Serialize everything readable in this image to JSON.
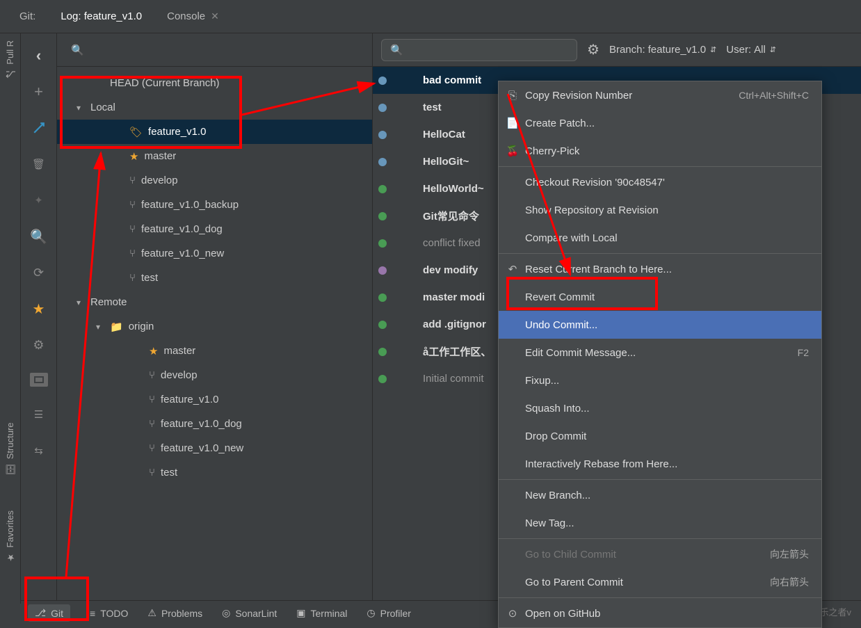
{
  "top_tabs": {
    "git_label": "Git:",
    "log_label": "Log: feature_v1.0",
    "console_label": "Console"
  },
  "vert_labels": {
    "pull": "Pull R",
    "structure": "Structure",
    "favorites": "Favorites"
  },
  "toolbar_left": {
    "back": "‹"
  },
  "tree": {
    "head": "HEAD (Current Branch)",
    "local": "Local",
    "local_items": [
      {
        "name": "feature_v1.0",
        "icon": "tag",
        "sel": true
      },
      {
        "name": "master",
        "icon": "star"
      },
      {
        "name": "develop",
        "icon": "branch"
      },
      {
        "name": "feature_v1.0_backup",
        "icon": "branch"
      },
      {
        "name": "feature_v1.0_dog",
        "icon": "branch"
      },
      {
        "name": "feature_v1.0_new",
        "icon": "branch"
      },
      {
        "name": "test",
        "icon": "branch"
      }
    ],
    "remote": "Remote",
    "origin": "origin",
    "remote_items": [
      {
        "name": "master",
        "icon": "star"
      },
      {
        "name": "develop",
        "icon": "branch"
      },
      {
        "name": "feature_v1.0",
        "icon": "branch"
      },
      {
        "name": "feature_v1.0_dog",
        "icon": "branch"
      },
      {
        "name": "feature_v1.0_new",
        "icon": "branch"
      },
      {
        "name": "test",
        "icon": "branch"
      }
    ]
  },
  "right_top": {
    "branch_prefix": "Branch: ",
    "branch_value": "feature_v1.0",
    "user_prefix": "User: ",
    "user_value": "All"
  },
  "commits": [
    {
      "msg": "bad commit",
      "sel": true,
      "color": "b"
    },
    {
      "msg": "test",
      "color": "b"
    },
    {
      "msg": "HelloCat",
      "color": "b"
    },
    {
      "msg": "HelloGit~",
      "color": "b"
    },
    {
      "msg": "HelloWorld~",
      "color": "g"
    },
    {
      "msg": "Git常见命令",
      "color": "g"
    },
    {
      "msg": "conflict fixed",
      "dim": true,
      "color": "g"
    },
    {
      "msg": "dev modify",
      "color": "p"
    },
    {
      "msg": "master modi",
      "color": "g"
    },
    {
      "msg": "add .gitignor",
      "color": "g"
    },
    {
      "msg": "å工作工作区、",
      "color": "g"
    },
    {
      "msg": "Initial commit",
      "dim": true,
      "color": "g"
    }
  ],
  "ctx": {
    "copy_rev": "Copy Revision Number",
    "copy_rev_short": "Ctrl+Alt+Shift+C",
    "create_patch": "Create Patch...",
    "cherry": "Cherry-Pick",
    "checkout_rev": "Checkout Revision '90c48547'",
    "show_repo": "Show Repository at Revision",
    "compare_local": "Compare with Local",
    "reset": "Reset Current Branch to Here...",
    "revert": "Revert Commit",
    "undo": "Undo Commit...",
    "edit_msg": "Edit Commit Message...",
    "edit_msg_short": "F2",
    "fixup": "Fixup...",
    "squash": "Squash Into...",
    "drop": "Drop Commit",
    "rebase": "Interactively Rebase from Here...",
    "new_branch": "New Branch...",
    "new_tag": "New Tag...",
    "child": "Go to Child Commit",
    "child_short": "向左箭头",
    "parent": "Go to Parent Commit",
    "parent_short": "向右箭头",
    "github": "Open on GitHub"
  },
  "bottom": {
    "git": "Git",
    "todo": "TODO",
    "problems": "Problems",
    "sonar": "SonarLint",
    "terminal": "Terminal",
    "profiler": "Profiler"
  },
  "watermark": "CSDN @乐之者v"
}
